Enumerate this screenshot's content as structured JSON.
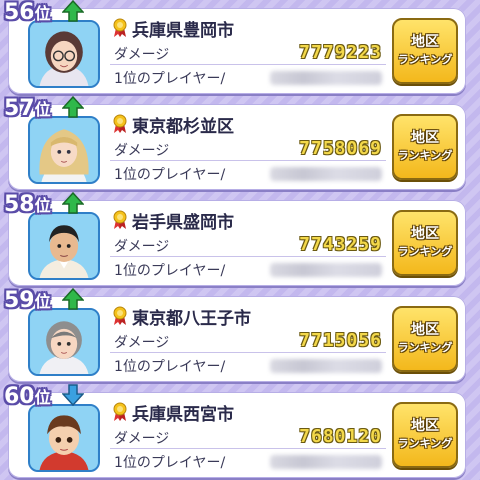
{
  "colors": {
    "accent": "#f3d84a",
    "button": "#f3b81c",
    "rank_outline": "#5a4ca8",
    "up_arrow": "#2fb84a",
    "down_arrow": "#3aa0e0"
  },
  "entries": [
    {
      "rank": "56",
      "rank_suffix": "位",
      "trend": "up",
      "city": "兵庫県豊岡市",
      "damage_label": "ダメージ",
      "damage": "7779223",
      "player_label": "1位のプレイヤー/",
      "button_line1": "地区",
      "button_line2": "ランキング",
      "avatar": "woman-glasses"
    },
    {
      "rank": "57",
      "rank_suffix": "位",
      "trend": "up",
      "city": "東京都杉並区",
      "damage_label": "ダメージ",
      "damage": "7758069",
      "player_label": "1位のプレイヤー/",
      "button_line1": "地区",
      "button_line2": "ランキング",
      "avatar": "blonde-girl"
    },
    {
      "rank": "58",
      "rank_suffix": "位",
      "trend": "up",
      "city": "岩手県盛岡市",
      "damage_label": "ダメージ",
      "damage": "7743259",
      "player_label": "1位のプレイヤー/",
      "button_line1": "地区",
      "button_line2": "ランキング",
      "avatar": "dark-hair-man"
    },
    {
      "rank": "59",
      "rank_suffix": "位",
      "trend": "up",
      "city": "東京都八王子市",
      "damage_label": "ダメージ",
      "damage": "7715056",
      "player_label": "1位のプレイヤー/",
      "button_line1": "地区",
      "button_line2": "ランキング",
      "avatar": "gray-hair-woman"
    },
    {
      "rank": "60",
      "rank_suffix": "位",
      "trend": "down",
      "city": "兵庫県西宮市",
      "damage_label": "ダメージ",
      "damage": "7680120",
      "player_label": "1位のプレイヤー/",
      "button_line1": "地区",
      "button_line2": "ランキング",
      "avatar": "red-cap-boy"
    }
  ]
}
